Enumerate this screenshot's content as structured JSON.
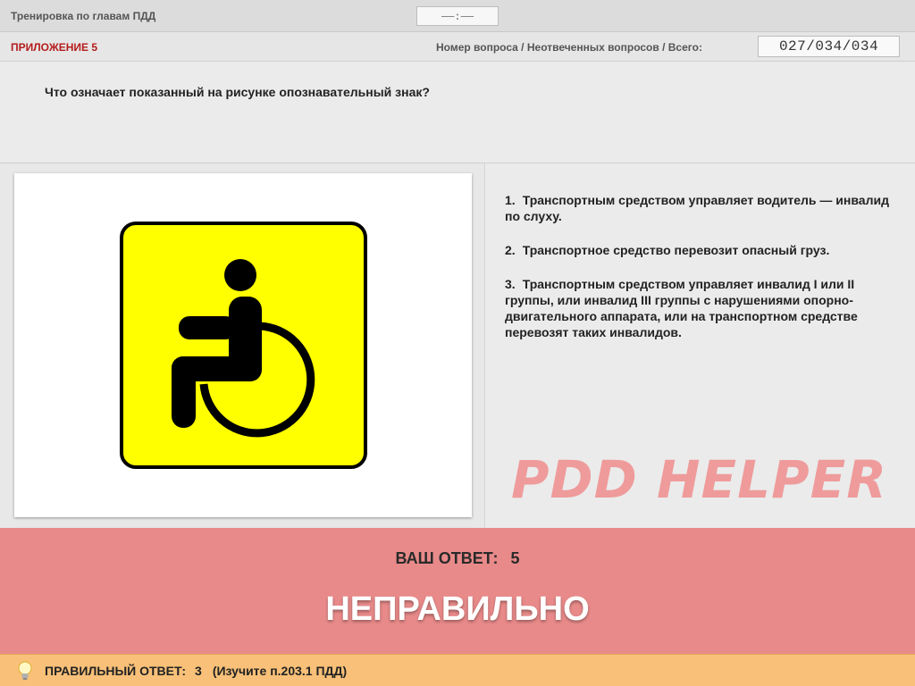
{
  "header": {
    "title": "Тренировка по главам ПДД",
    "timer": "——:——"
  },
  "info": {
    "appendix": "ПРИЛОЖЕНИЕ 5",
    "counter_label": "Номер вопроса / Неотвеченных вопросов / Всего:",
    "counter_value": "027/034/034"
  },
  "question": {
    "text": "Что означает показанный на рисунке опознавательный знак?",
    "image": {
      "description_icon": "wheelchair-sign-icon",
      "sign_color": "#ffff00",
      "border_color": "#000000"
    }
  },
  "answers": [
    {
      "num": "1.",
      "text": "Транспортным средством управляет водитель — инвалид по слуху."
    },
    {
      "num": "2.",
      "text": "Транспортное средство перевозит опасный груз."
    },
    {
      "num": "3.",
      "text": "Транспортным средством управляет инвалид I или II группы, или инвалид III группы с нарушениями опорно-двигательного аппарата, или на транспортном средстве перевозят таких инвалидов."
    }
  ],
  "watermark": "PDD HELPER",
  "result": {
    "your_label": "ВАШ  ОТВЕТ:",
    "your_value": "5",
    "verdict": "НЕПРАВИЛЬНО"
  },
  "footer": {
    "correct_label": "ПРАВИЛЬНЫЙ ОТВЕТ:",
    "correct_value": "3",
    "hint": "(Изучите п.203.1 ПДД)",
    "icon": "lightbulb-icon"
  },
  "colors": {
    "appendix_red": "#b51c1c",
    "result_bg": "#e98a8a",
    "footer_bg": "#f8c078",
    "watermark": "#ef9b9b"
  }
}
